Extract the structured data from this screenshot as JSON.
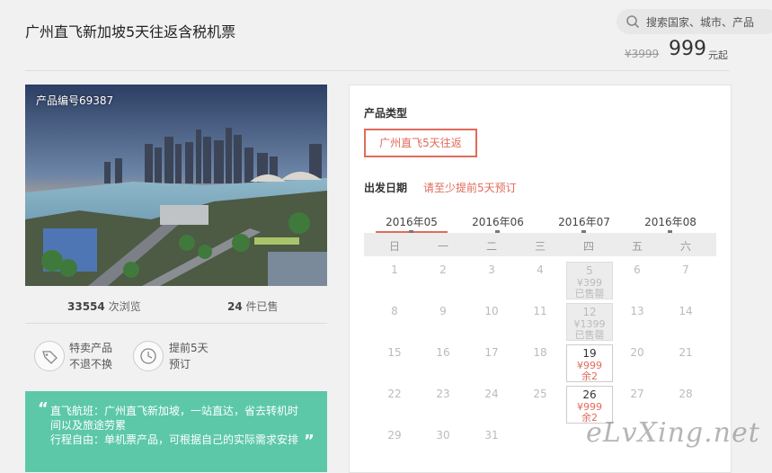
{
  "page": {
    "title": "广州直飞新加坡5天往返含税机票"
  },
  "search": {
    "placeholder": "搜索国家、城市、产品"
  },
  "price": {
    "original": "¥3999",
    "current": "999",
    "suffix": "元起"
  },
  "photo": {
    "product_id": "产品编号69387"
  },
  "stats": {
    "views": "33554",
    "views_label": "次浏览",
    "sold": "24",
    "sold_label": "件已售"
  },
  "badges": [
    {
      "line1": "特卖产品",
      "line2": "不退不换",
      "icon": "tag-icon"
    },
    {
      "line1": "提前5天",
      "line2": "预订",
      "icon": "clock-icon"
    }
  ],
  "note": {
    "line1": "直飞航班：广州直飞新加坡，一站直达，省去转机时",
    "line2": "间以及旅途劳累",
    "line3": "行程自由：单机票产品，可根据自己的实际需求安排"
  },
  "product_type": {
    "label": "产品类型",
    "option": "广州直飞5天往返"
  },
  "departure": {
    "label": "出发日期",
    "hint": "请至少提前5天预订"
  },
  "months": [
    "2016年05",
    "2016年06",
    "2016年07",
    "2016年08"
  ],
  "weekdays": [
    "日",
    "一",
    "二",
    "三",
    "四",
    "五",
    "六"
  ],
  "calendar": {
    "rows": [
      [
        {
          "d": "1"
        },
        {
          "d": "2"
        },
        {
          "d": "3"
        },
        {
          "d": "4"
        },
        {
          "d": "5",
          "p": "¥399",
          "s": "已售罄",
          "state": "booked"
        },
        {
          "d": "6"
        },
        {
          "d": "7"
        }
      ],
      [
        {
          "d": "8"
        },
        {
          "d": "9"
        },
        {
          "d": "10"
        },
        {
          "d": "11"
        },
        {
          "d": "12",
          "p": "¥1399",
          "s": "已售罄",
          "state": "booked"
        },
        {
          "d": "13"
        },
        {
          "d": "14"
        }
      ],
      [
        {
          "d": "15"
        },
        {
          "d": "16"
        },
        {
          "d": "17"
        },
        {
          "d": "18"
        },
        {
          "d": "19",
          "p": "¥999",
          "s": "余2",
          "state": "avail"
        },
        {
          "d": "20"
        },
        {
          "d": "21"
        }
      ],
      [
        {
          "d": "22"
        },
        {
          "d": "23"
        },
        {
          "d": "24"
        },
        {
          "d": "25"
        },
        {
          "d": "26",
          "p": "¥999",
          "s": "余2",
          "state": "avail"
        },
        {
          "d": "27"
        },
        {
          "d": "28"
        }
      ],
      [
        {
          "d": "29"
        },
        {
          "d": "30"
        },
        {
          "d": "31"
        }
      ]
    ]
  },
  "watermark": "eLvXing.net"
}
